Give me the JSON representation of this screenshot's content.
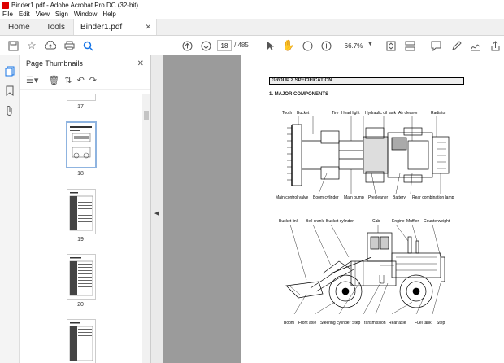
{
  "window": {
    "title": "Binder1.pdf - Adobe Acrobat Pro DC (32-bit)"
  },
  "menu": [
    "File",
    "Edit",
    "View",
    "Sign",
    "Window",
    "Help"
  ],
  "tabs": {
    "home": "Home",
    "tools": "Tools",
    "document": "Binder1.pdf"
  },
  "toolbar": {
    "current_page": "18",
    "total_pages": "/ 485",
    "zoom": "66.7%"
  },
  "panel": {
    "title": "Page Thumbnails",
    "thumbnails": [
      "17",
      "18",
      "19",
      "20"
    ]
  },
  "document": {
    "section_title": "GROUP 2 SPECIFICATION",
    "subsection_title": "1. MAJOR COMPONENTS",
    "top_labels": [
      "Tooth",
      "Bucket",
      "Tire",
      "Head light",
      "Hydraulic oil tank",
      "Air cleaner",
      "Radiator"
    ],
    "mid_labels": [
      "Main control valve",
      "Boom cylinder",
      "Main pump",
      "Precleaner",
      "Battery",
      "Rear combination lamp"
    ],
    "side_top_labels": [
      "Bucket link",
      "Bell crank",
      "Bucket cylinder",
      "Cab",
      "Engine",
      "Muffler",
      "Counterweight"
    ],
    "bottom_labels": [
      "Boom",
      "Front axle",
      "Steering cylinder",
      "Step",
      "Transmission",
      "Rear axle",
      "Fuel tank",
      "Step"
    ]
  },
  "colors": {
    "doc_bg": "#9b9b9b",
    "accent": "#1473e6"
  }
}
